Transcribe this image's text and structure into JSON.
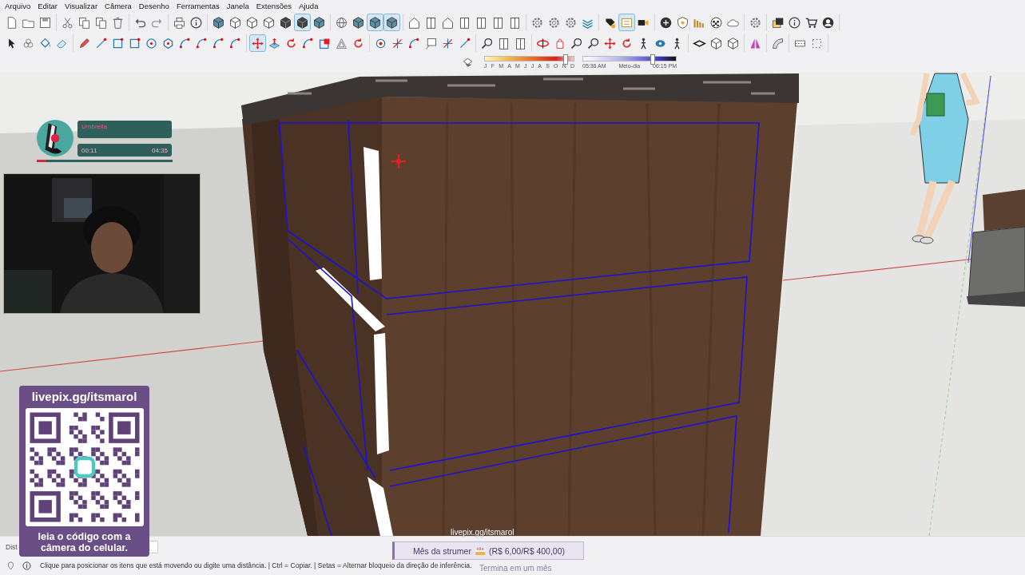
{
  "menu": [
    "Arquivo",
    "Editar",
    "Visualizar",
    "Câmera",
    "Desenho",
    "Ferramentas",
    "Janela",
    "Extensões",
    "Ajuda"
  ],
  "toolbar_rows": [
    {
      "groups": [
        {
          "buttons": [
            {
              "selected": false
            },
            {
              "selected": false
            },
            {
              "selected": false
            }
          ]
        },
        {
          "buttons": [
            {
              "selected": false
            },
            {
              "selected": false
            },
            {
              "selected": false
            },
            {
              "selected": false
            }
          ]
        },
        {
          "buttons": [
            {
              "selected": false
            },
            {
              "selected": false
            }
          ]
        },
        {
          "buttons": [
            {
              "selected": false
            },
            {
              "selected": false
            }
          ]
        },
        {
          "buttons": [
            {
              "selected": false
            },
            {
              "selected": false
            },
            {
              "selected": false
            },
            {
              "selected": false
            },
            {
              "selected": false
            },
            {
              "selected": true
            },
            {
              "selected": false
            }
          ]
        },
        {
          "buttons": [
            {
              "selected": false
            },
            {
              "selected": false
            },
            {
              "selected": true
            },
            {
              "selected": true
            }
          ]
        },
        {
          "buttons": [
            {
              "selected": false
            },
            {
              "selected": false
            },
            {
              "selected": false
            },
            {
              "selected": false
            },
            {
              "selected": false
            },
            {
              "selected": false
            },
            {
              "selected": false
            }
          ]
        },
        {
          "buttons": [
            {
              "selected": false
            },
            {
              "selected": false
            },
            {
              "selected": false
            },
            {
              "selected": false
            }
          ]
        },
        {
          "buttons": [
            {
              "selected": false
            },
            {
              "selected": true
            },
            {
              "selected": false
            }
          ]
        },
        {
          "buttons": [
            {
              "selected": false
            },
            {
              "selected": false
            },
            {
              "selected": false
            },
            {
              "selected": false
            },
            {
              "selected": false
            }
          ]
        },
        {
          "buttons": [
            {
              "selected": false
            }
          ]
        },
        {
          "buttons": [
            {
              "selected": false
            },
            {
              "selected": false
            },
            {
              "selected": false
            },
            {
              "selected": false
            }
          ]
        }
      ]
    },
    {
      "groups": [
        {
          "buttons": [
            {
              "selected": false
            },
            {
              "selected": false
            },
            {
              "selected": false
            },
            {
              "selected": false
            }
          ]
        },
        {
          "buttons": [
            {
              "selected": false
            },
            {
              "selected": false
            },
            {
              "selected": false
            },
            {
              "selected": false
            },
            {
              "selected": false
            },
            {
              "selected": false
            },
            {
              "selected": false
            },
            {
              "selected": false
            },
            {
              "selected": false
            },
            {
              "selected": false
            }
          ]
        },
        {
          "buttons": [
            {
              "selected": true
            },
            {
              "selected": false
            },
            {
              "selected": false
            },
            {
              "selected": false
            },
            {
              "selected": false
            },
            {
              "selected": false
            },
            {
              "selected": false
            }
          ]
        },
        {
          "buttons": [
            {
              "selected": false
            },
            {
              "selected": false
            },
            {
              "selected": false
            },
            {
              "selected": false
            },
            {
              "selected": false
            },
            {
              "selected": false
            }
          ]
        },
        {
          "buttons": [
            {
              "selected": false
            },
            {
              "selected": false
            },
            {
              "selected": false
            }
          ]
        },
        {
          "buttons": [
            {
              "selected": false
            },
            {
              "selected": false
            },
            {
              "selected": false
            },
            {
              "selected": false
            },
            {
              "selected": false
            },
            {
              "selected": false
            },
            {
              "selected": false
            },
            {
              "selected": false
            },
            {
              "selected": false
            }
          ]
        },
        {
          "buttons": [
            {
              "selected": false
            },
            {
              "selected": false
            },
            {
              "selected": false
            }
          ]
        },
        {
          "buttons": [
            {
              "selected": false
            }
          ]
        },
        {
          "buttons": [
            {
              "selected": false
            }
          ]
        },
        {
          "buttons": [
            {
              "selected": false
            },
            {
              "selected": false
            }
          ]
        }
      ]
    }
  ],
  "shadow_panel": {
    "date_slider": {
      "level": 0.9,
      "labels": [
        "J",
        "F",
        "M",
        "A",
        "M",
        "J",
        "J",
        "A",
        "S",
        "O",
        "N",
        "D"
      ]
    },
    "time_slider": {
      "level": 0.74,
      "labels": [
        "05:36 AM",
        "Meio-dia",
        "06:15 PM"
      ]
    }
  },
  "music_player": {
    "title": "Umbrella",
    "elapsed": "00:11",
    "duration": "04:35",
    "progress": {
      "level": 0.07
    }
  },
  "qr_card": {
    "heading": "livepix.gg/itsmarol",
    "caption": "leia o código com a câmera do celular."
  },
  "goal": {
    "url": "livepix.gg/itsmarol",
    "label": "Mês da strumer",
    "amount": "(R$ 6,00/R$ 400,00)",
    "note": "Termina em um mês"
  },
  "status_bar": {
    "measure_label": "Dist",
    "message": "Clique para posicionar os itens que está movendo ou digite uma distância. | Ctrl = Copiar. | Setas = Alternar bloqueio da direção de inferência."
  }
}
